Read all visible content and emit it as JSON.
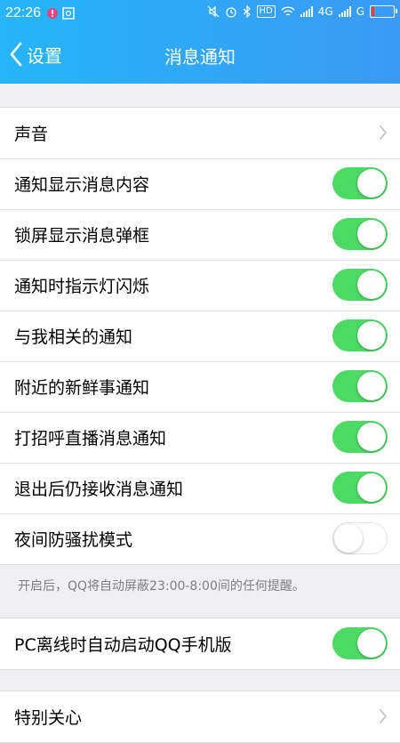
{
  "status_bar": {
    "time": "22:26",
    "network_4g": "4G",
    "network_g": "G",
    "hd_label": "HD"
  },
  "nav": {
    "back_label": "设置",
    "title": "消息通知"
  },
  "settings": [
    {
      "label": "声音",
      "type": "chevron"
    },
    {
      "label": "通知显示消息内容",
      "type": "toggle",
      "on": true
    },
    {
      "label": "锁屏显示消息弹框",
      "type": "toggle",
      "on": true
    },
    {
      "label": "通知时指示灯闪烁",
      "type": "toggle",
      "on": true
    },
    {
      "label": "与我相关的通知",
      "type": "toggle",
      "on": true
    },
    {
      "label": "附近的新鲜事通知",
      "type": "toggle",
      "on": true
    },
    {
      "label": "打招呼直播消息通知",
      "type": "toggle",
      "on": true
    },
    {
      "label": "退出后仍接收消息通知",
      "type": "toggle",
      "on": true
    },
    {
      "label": "夜间防骚扰模式",
      "type": "toggle",
      "on": false
    }
  ],
  "night_mode_note": "开启后，QQ将自动屏蔽23:00-8:00间的任何提醒。",
  "pc_offline": {
    "label": "PC离线时自动启动QQ手机版",
    "on": true
  },
  "special": {
    "label": "特别关心"
  },
  "colors": {
    "accent": "#3b9af4",
    "toggle_on": "#4cd964"
  }
}
